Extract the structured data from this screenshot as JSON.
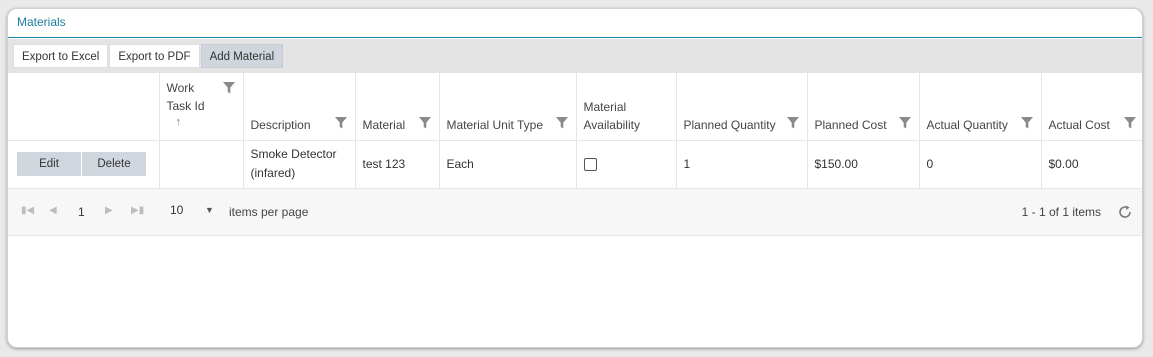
{
  "panel": {
    "title": "Materials"
  },
  "toolbar": {
    "export_excel": "Export to Excel",
    "export_pdf": "Export to PDF",
    "add_material": "Add Material"
  },
  "columns": {
    "work_task_id": "Work Task Id",
    "description": "Description",
    "material": "Material",
    "unit_type": "Material Unit Type",
    "availability": "Material Availability",
    "planned_quantity": "Planned Quantity",
    "planned_cost": "Planned Cost",
    "actual_quantity": "Actual Quantity",
    "actual_cost": "Actual Cost"
  },
  "rows": [
    {
      "edit_label": "Edit",
      "delete_label": "Delete",
      "work_task_id": "",
      "description": "Smoke Detector (infared)",
      "material": "test 123",
      "unit_type": "Each",
      "availability": false,
      "planned_quantity": "1",
      "planned_cost": "$150.00",
      "actual_quantity": "0",
      "actual_cost": "$0.00"
    }
  ],
  "pager": {
    "current_page": "1",
    "page_size": "10",
    "page_size_label": "items per page",
    "info": "1 - 1 of 1 items"
  },
  "icons": {
    "filter": "filter-icon",
    "sort": "sort-arrow-up-icon",
    "first": "first-page-icon",
    "prev": "prev-page-icon",
    "next": "next-page-icon",
    "last": "last-page-icon",
    "refresh": "refresh-icon",
    "dropdown": "chevron-down-icon"
  },
  "colors": {
    "title": "#1a7ea0",
    "action_button": "#cfd6dd",
    "toolbar_bg": "#e4e4e4"
  }
}
